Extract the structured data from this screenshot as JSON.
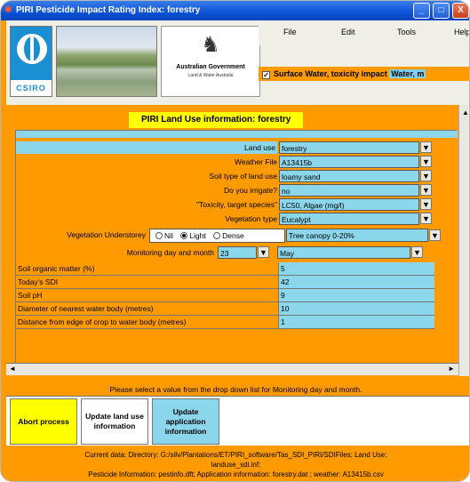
{
  "window": {
    "title": "PIRI Pesticide Impact Rating Index: forestry",
    "min_glyph": "_",
    "max_glyph": "□",
    "close_glyph": "X",
    "icon_glyph": "✱"
  },
  "header": {
    "csiro_text": "CSIRO",
    "gov_line1": "Australian Government",
    "gov_line2": "Land & Water Australia",
    "crest_glyph": "♞"
  },
  "menu": {
    "items": [
      "File",
      "Edit",
      "Tools",
      "Help"
    ]
  },
  "impact": {
    "checked": true,
    "check_glyph": "✓",
    "label": "Surface Water, toxicity impact",
    "tail": "Water, m"
  },
  "info": {
    "title": "PIRI Land Use information: forestry"
  },
  "form": {
    "dd_glyph": "▼",
    "rows": [
      {
        "label": "Land use",
        "value": "forestry"
      },
      {
        "label": "Weather File",
        "value": "A13415b"
      },
      {
        "label": "Soil type of land use",
        "value": "loamy sand"
      },
      {
        "label": "Do you irrigate?",
        "value": "no"
      },
      {
        "label": "\"Toxicity, target species\"",
        "value": "LC50, Algae (mg/l)"
      },
      {
        "label": "Vegetation type",
        "value": "Eucalypt"
      }
    ],
    "understorey": {
      "label": "Vegetation Understorey",
      "options": [
        "Nil",
        "Light",
        "Dense"
      ],
      "selected": "Light",
      "value": "Tree canopy 0-20%"
    },
    "monitoring": {
      "label": "Monitoring day and month",
      "day": "23",
      "month": "May"
    },
    "params": [
      {
        "label": "Soil organic matter (%)",
        "value": "5"
      },
      {
        "label": "Today's SDI",
        "value": "42"
      },
      {
        "label": "Soil pH",
        "value": "9"
      },
      {
        "label": "Diameter of nearest water body (metres)",
        "value": "10"
      },
      {
        "label": "Distance from edge of crop to water body (metres)",
        "value": "1"
      }
    ]
  },
  "scroll": {
    "left": "◄",
    "right": "►",
    "up": "▲"
  },
  "status": "Please select a value from the drop down list for Monitoring day and month.",
  "buttons": {
    "abort": "Abort process",
    "update_land": "Update land use information",
    "update_app": "Update application information"
  },
  "footer": {
    "line1": "Current data: Directory: G:/silv/Plantations/ET/PIRI_software/Tas_SDI_PIRI/SDIFiles; Land Use:",
    "line2": "landuse_sdi.inf;",
    "line3": "Pesticide Information: pestinfo.dft; Application information: forestry.dat ; weather: A13415b.csv"
  },
  "colors": {
    "orange": "#ff9a00",
    "cyan": "#8cd6ec",
    "blue_button": "#8cd6ec",
    "title_yellow": "#ffff00"
  }
}
